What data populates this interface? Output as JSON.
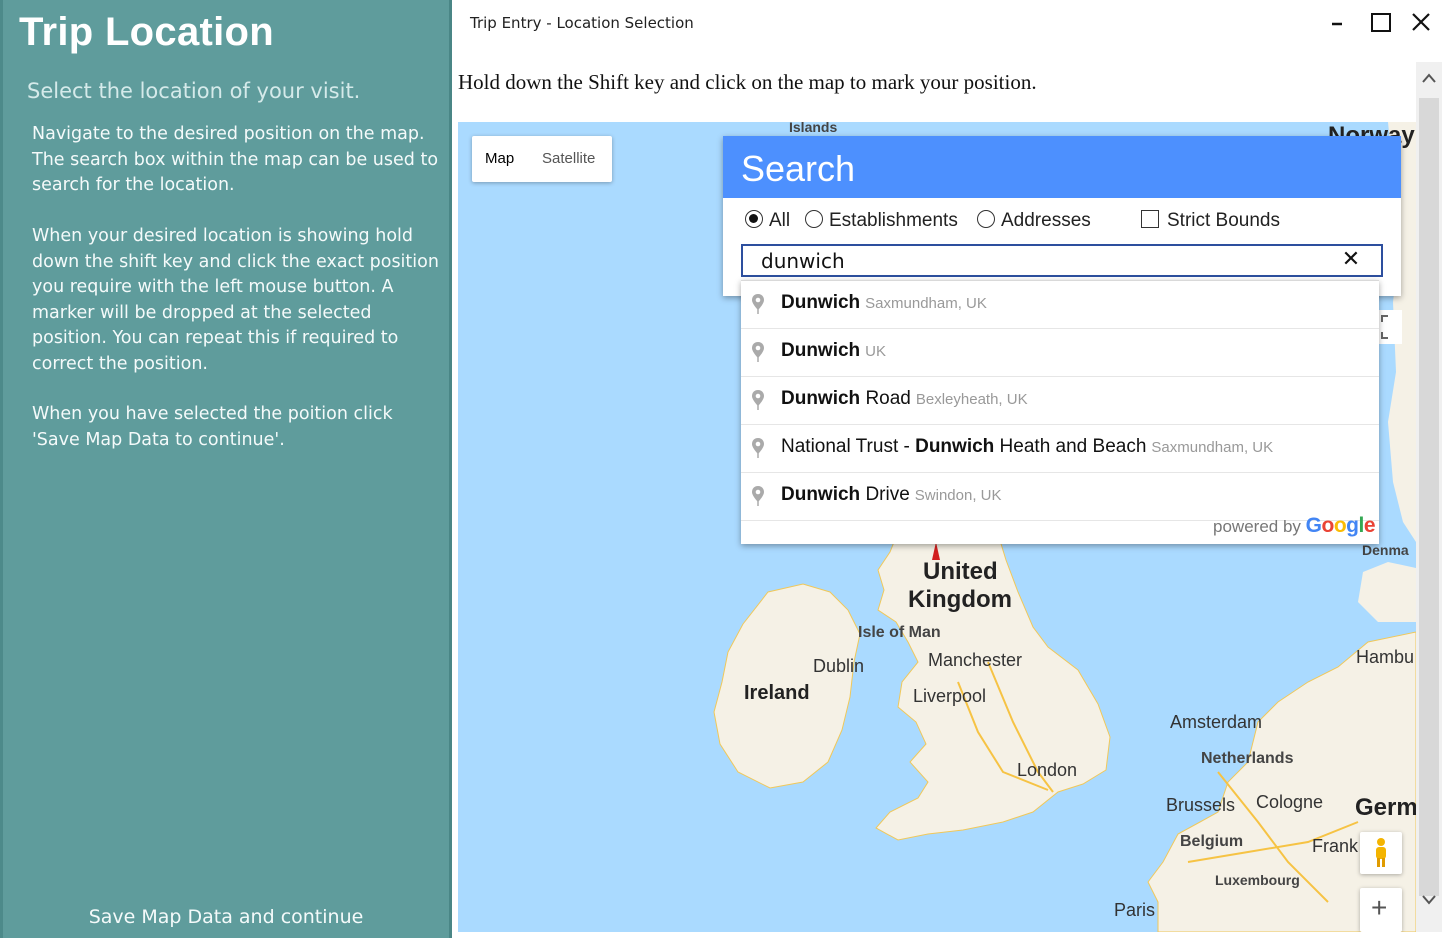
{
  "sidebar": {
    "title": "Trip Location",
    "subtitle": "Select the location of your visit.",
    "paragraphs": [
      "Navigate to the desired position on the map. The search box within the map can be used to search for the location.",
      "When your desired location is showing hold down the shift key and click the exact position you require with the left mouse button. A marker will be dropped at the selected position. You can repeat this if required to correct the position.",
      "When you have selected the poition click 'Save Map Data to continue'."
    ],
    "save_label": "Save Map Data and continue"
  },
  "window": {
    "title": "Trip Entry - Location Selection",
    "instruction": "Hold down the Shift key and click on the map to mark your position."
  },
  "map": {
    "type_map": "Map",
    "type_satellite": "Satellite",
    "zoom_in": "+",
    "labels": {
      "islands": "Islands",
      "norway": "Norway",
      "united": "United",
      "kingdom": "Kingdom",
      "isle_of_man": "Isle of Man",
      "dublin": "Dublin",
      "ireland": "Ireland",
      "manchester": "Manchester",
      "liverpool": "Liverpool",
      "london": "London",
      "amsterdam": "Amsterdam",
      "netherlands": "Netherlands",
      "brussels": "Brussels",
      "cologne": "Cologne",
      "belgium": "Belgium",
      "luxembourg": "Luxembourg",
      "paris": "Paris",
      "frank": "Frank",
      "germ": "Germ",
      "hambu": "Hambu",
      "denma": "Denma"
    }
  },
  "search": {
    "header": "Search",
    "options": {
      "all": "All",
      "establishments": "Establishments",
      "addresses": "Addresses",
      "strict_bounds": "Strict Bounds"
    },
    "value": "dunwich",
    "clear": "✕",
    "suggestions": [
      {
        "pre": "",
        "match": "Dunwich",
        "post": "",
        "secondary": "Saxmundham, UK"
      },
      {
        "pre": "",
        "match": "Dunwich",
        "post": "",
        "secondary": "UK"
      },
      {
        "pre": "",
        "match": "Dunwich",
        "post": " Road",
        "secondary": "Bexleyheath, UK"
      },
      {
        "pre": "National Trust - ",
        "match": "Dunwich",
        "post": " Heath and Beach",
        "secondary": "Saxmundham, UK"
      },
      {
        "pre": "",
        "match": "Dunwich",
        "post": " Drive",
        "secondary": "Swindon, UK"
      }
    ],
    "powered_by": "powered by",
    "google": "Google"
  },
  "colors": {
    "sidebar_bg": "#5f9c9c",
    "search_header": "#4d90fe",
    "sea": "#aadaff",
    "land": "#f5f1e6"
  }
}
